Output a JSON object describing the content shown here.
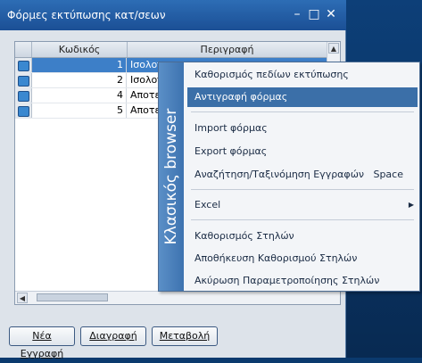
{
  "window": {
    "title": "Φόρμες εκτύπωσης κατ/σεων",
    "minimize_icon": "minimize-icon",
    "maximize_icon": "maximize-icon",
    "close_icon": "close-icon"
  },
  "grid": {
    "columns": [
      "Κωδικός",
      "Περιγραφή"
    ],
    "rows": [
      {
        "code": "1",
        "desc": "Ισολογ",
        "selected": true
      },
      {
        "code": "2",
        "desc": "Ισολογ",
        "selected": false
      },
      {
        "code": "4",
        "desc": "Αποτε",
        "selected": false
      },
      {
        "code": "5",
        "desc": "Αποτε",
        "selected": false
      }
    ],
    "row_icon": "record-icon"
  },
  "buttons": {
    "new": "Νέα Εγγραφή",
    "delete": "Διαγραφή",
    "edit": "Μεταβολή"
  },
  "context_menu": {
    "band_label": "Κλασικός browser",
    "items": [
      {
        "label": "Καθορισμός πεδίων εκτύπωσης"
      },
      {
        "label": "Αντιγραφή φόρμας",
        "highlighted": true
      },
      {
        "label": "Import φόρμας"
      },
      {
        "label": "Export φόρμας"
      },
      {
        "label": "Αναζήτηση/Ταξινόμηση Εγγραφών",
        "shortcut": "Space"
      },
      {
        "label": "Excel",
        "submenu_icon": "submenu-arrow-icon"
      },
      {
        "label": "Καθορισμός Στηλών"
      },
      {
        "label": "Αποθήκευση Καθορισμού Στηλών"
      },
      {
        "label": "Ακύρωση Παραμετροποίησης Στηλών"
      }
    ]
  },
  "colors": {
    "title_bar": "#1b4f95",
    "selection": "#3d7fc8",
    "menu_band": "#3d73b0",
    "menu_highlight": "#3b6fa8"
  }
}
